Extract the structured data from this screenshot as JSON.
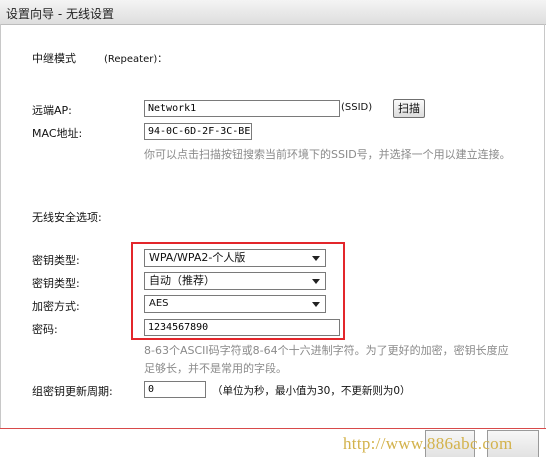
{
  "title": "设置向导 - 无线设置",
  "mode_label": "中继模式",
  "mode_value": "(Repeater)：",
  "remote_ap_label": "远端AP:",
  "remote_ap_value": "Network1",
  "ssid_label": "(SSID)",
  "scan_button": "扫描",
  "mac_label": "MAC地址:",
  "mac_value": "94-0C-6D-2F-3C-BE",
  "hint1": "你可以点击扫描按钮搜索当前环境下的SSID号，并选择一个用以建立连接。",
  "security_title": "无线安全选项:",
  "key_type_label_1": "密钥类型:",
  "key_type_value_1": "WPA/WPA2-个人版",
  "key_type_label_2": "密钥类型:",
  "key_type_value_2": "自动（推荐）",
  "encryption_label": "加密方式:",
  "encryption_value": "AES",
  "password_label": "密码:",
  "password_value": "1234567890",
  "hint2": "8-63个ASCII码字符或8-64个十六进制字符。为了更好的加密，密钥长度应足够长，并不是常用的字段。",
  "group_key_label": "组密钥更新周期:",
  "group_key_value": "0",
  "group_key_hint": "（单位为秒，最小值为30，不更新则为0）",
  "watermark": "http://www.886abc.com"
}
